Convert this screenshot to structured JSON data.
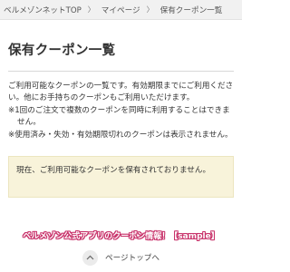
{
  "breadcrumb": {
    "items": [
      {
        "label": "ベルメゾンネットTOP"
      },
      {
        "label": "マイページ"
      },
      {
        "label": "保有クーポン一覧"
      }
    ],
    "separator": "〉"
  },
  "page": {
    "title": "保有クーポン一覧"
  },
  "description": {
    "intro": "ご利用可能なクーポンの一覧です。有効期限までにご利用ください。他にお手持ちのクーポンもご利用いただけます。",
    "note1": "※1回のご注文で複数のクーポンを同時に利用することはできません。",
    "note2": "※使用済み・失効・有効期限切れのクーポンは表示されません。"
  },
  "notice": {
    "text": "現在、ご利用可能なクーポンを保有されておりません。",
    "background": "#f8f3da"
  },
  "overlay_caption": {
    "text": "ベルメゾン公式アプリのクーポン情報！【sample】",
    "color": "#c8326a"
  },
  "footer": {
    "page_top_label": "ページトップへ",
    "icon": "chevron-up-icon"
  }
}
